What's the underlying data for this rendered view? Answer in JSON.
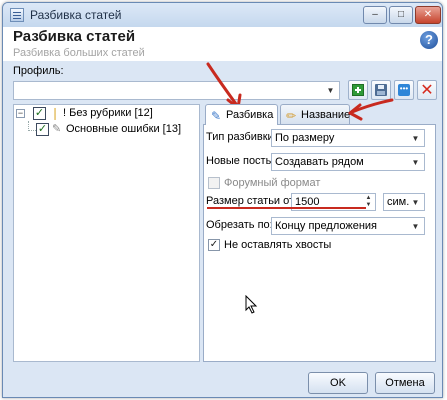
{
  "window": {
    "title": "Разбивка статей",
    "controls": {
      "minimize": "–",
      "maximize": "□",
      "close": "✕"
    }
  },
  "header": {
    "title": "Разбивка статей",
    "subtitle": "Разбивка больших статей",
    "help_icon": "?"
  },
  "profile": {
    "label": "Профиль:",
    "value": "",
    "toolbar_icons": [
      "add-icon",
      "save-icon",
      "more-icon",
      "delete-icon"
    ]
  },
  "tree": {
    "items": [
      {
        "label": "! Без рубрики [12]",
        "checked": true,
        "expanded": true,
        "icon": "folder-icon"
      },
      {
        "label": "Основные ошибки [13]",
        "checked": true,
        "icon": "pen-icon"
      }
    ]
  },
  "tabs": [
    {
      "label": "Разбивка",
      "active": true,
      "icon": "split-icon"
    },
    {
      "label": "Название",
      "active": false,
      "icon": "pencil-icon"
    }
  ],
  "form": {
    "split_type_label": "Тип разбивки:",
    "split_type_value": "По размеру",
    "new_posts_label": "Новые посты:",
    "new_posts_value": "Создавать рядом",
    "forum_format_label": "Форумный формат",
    "forum_format_checked": false,
    "size_label": "Размер статьи от:",
    "size_value": "1500",
    "unit_value": "сим.",
    "cut_label": "Обрезать по:",
    "cut_value": "Концу предложения",
    "no_tails_label": "Не оставлять хвосты",
    "no_tails_checked": true
  },
  "buttons": {
    "ok": "OK",
    "cancel": "Отмена"
  },
  "colors": {
    "annotation_red": "#c82a1f",
    "window_bg": "#dbe6f4",
    "border": "#a9b9cf"
  }
}
